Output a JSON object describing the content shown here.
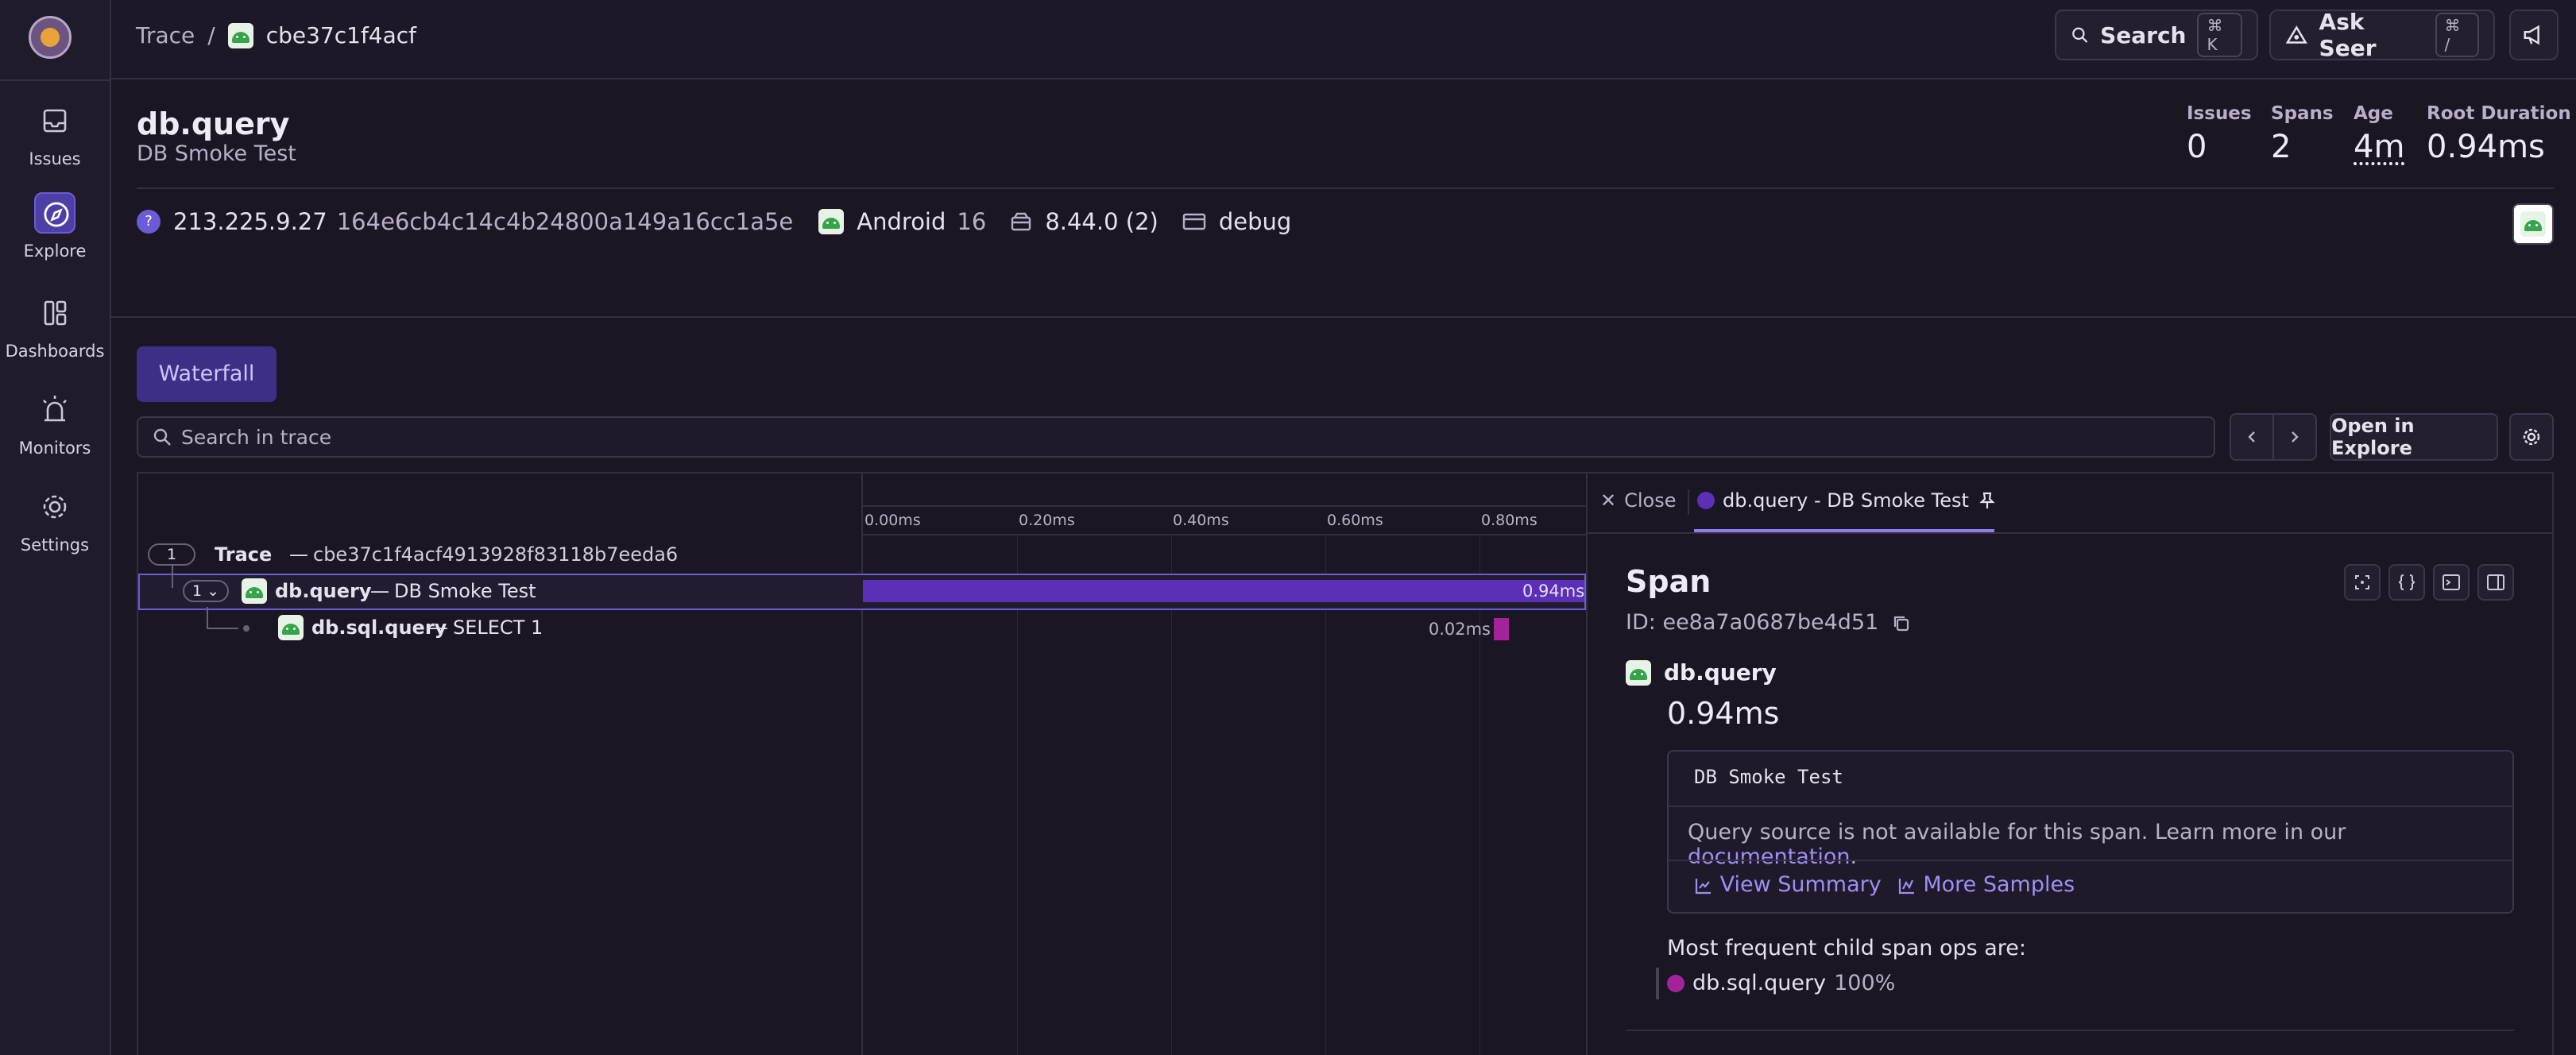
{
  "sidebar": {
    "items": [
      {
        "label": "Issues",
        "icon": "inbox-icon"
      },
      {
        "label": "Explore",
        "icon": "compass-icon",
        "active": true
      },
      {
        "label": "Dashboards",
        "icon": "dashboard-icon"
      },
      {
        "label": "Monitors",
        "icon": "siren-icon"
      },
      {
        "label": "Settings",
        "icon": "gear-icon"
      }
    ]
  },
  "header": {
    "breadcrumb_root": "Trace",
    "breadcrumb_sep": "/",
    "breadcrumb_current": "cbe37c1f4acf",
    "search_label": "Search",
    "search_kbd": "⌘ K",
    "ask_label": "Ask Seer",
    "ask_kbd": "⌘ /"
  },
  "trace": {
    "title": "db.query",
    "subtitle": "DB Smoke Test",
    "stats": [
      {
        "label": "Issues",
        "value": "0"
      },
      {
        "label": "Spans",
        "value": "2"
      },
      {
        "label": "Age",
        "value": "4m"
      },
      {
        "label": "Root Duration",
        "value": "0.94ms"
      }
    ],
    "tags": {
      "ip": "213.225.9.27",
      "device_id": "164e6cb4c14c4b24800a149a16cc1a5e",
      "os": "Android",
      "os_version": "16",
      "release": "8.44.0 (2)",
      "env": "debug"
    }
  },
  "waterfall": {
    "tab_label": "Waterfall",
    "search_placeholder": "Search in trace",
    "open_explore": "Open in Explore",
    "ticks": [
      "0.00ms",
      "0.20ms",
      "0.40ms",
      "0.60ms",
      "0.80ms"
    ],
    "rows": [
      {
        "count": "1",
        "op": "Trace",
        "sep": "—",
        "desc": "cbe37c1f4acf4913928f83118b7eeda6"
      },
      {
        "count": "1",
        "op": "db.query",
        "sep": "—",
        "desc": "DB Smoke Test",
        "duration": "0.94ms",
        "start_ms": 0,
        "duration_ms": 0.94
      },
      {
        "op": "db.sql.query",
        "sep": "—",
        "desc": "SELECT 1",
        "duration": "0.02ms",
        "start_ms": 0.82,
        "duration_ms": 0.02
      }
    ],
    "bar_colors": {
      "db_query": "#5b2fb6",
      "db_sql_query": "#a4239a"
    }
  },
  "details": {
    "close_label": "Close",
    "tab_label": "db.query - DB Smoke Test",
    "heading": "Span",
    "id_label": "ID:",
    "id_value": "ee8a7a0687be4d51",
    "op": "db.query",
    "duration": "0.94ms",
    "query": "DB Smoke Test",
    "note_text": "Query source is not available for this span. Learn more in our ",
    "note_link": "documentation",
    "note_end": ".",
    "view_summary": "View Summary",
    "more_samples": "More Samples",
    "freq_heading": "Most frequent child span ops are:",
    "freq_op": "db.sql.query",
    "freq_pct": "100%"
  }
}
